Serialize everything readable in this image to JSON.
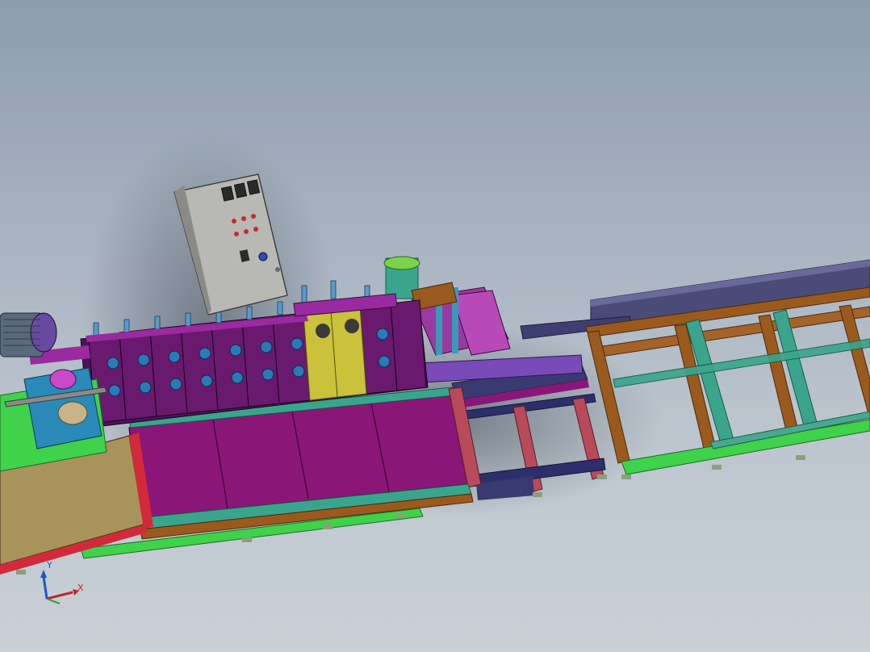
{
  "viewport": {
    "background_top": "#8e9cad",
    "background_bottom": "#c9d0d6"
  },
  "model": {
    "component_colors": {
      "base_panel": "#8a1678",
      "frame_teal": "#3aa58c",
      "frame_brown": "#9a5a1e",
      "frame_navy": "#2d2f6a",
      "roller_stand": "#6a1a6e",
      "roller_stand_yellow": "#c9c23a",
      "control_box": "#b8b8b4",
      "motor": "#5a6a7a",
      "end_plate_tan": "#b0965a",
      "conveyor_top": "#4a4a7a",
      "green_rail": "#3fd24a"
    },
    "control_panel_icon": "electrical-control-box-icon",
    "motor_icon": "electric-motor-icon"
  },
  "triad": {
    "x_label": "X",
    "y_label": "Y",
    "x_color": "#c0262e",
    "y_color": "#1e55c8",
    "z_color": "#2a9a3a"
  }
}
